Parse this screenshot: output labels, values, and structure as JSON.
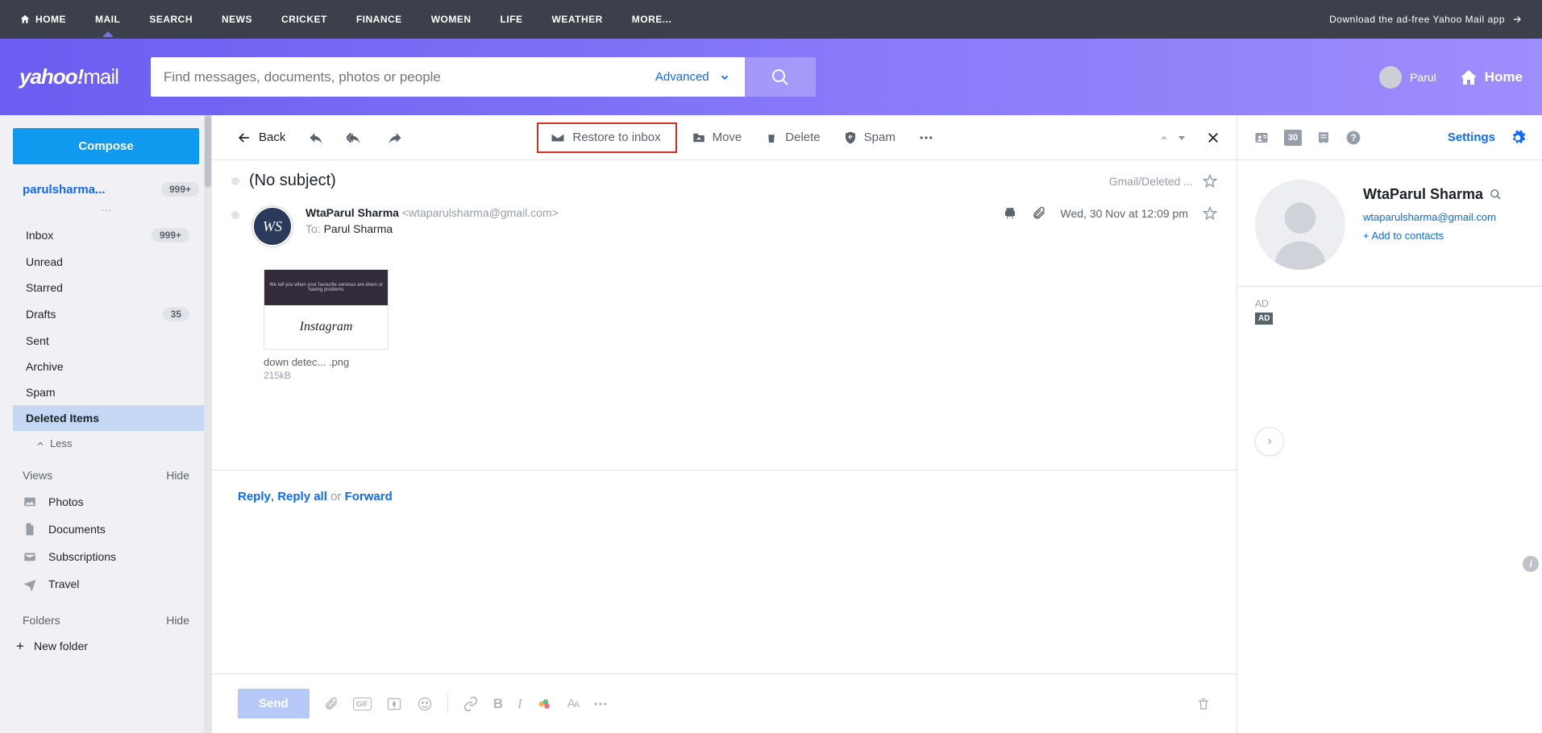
{
  "topnav": {
    "items": [
      "HOME",
      "MAIL",
      "SEARCH",
      "NEWS",
      "CRICKET",
      "FINANCE",
      "WOMEN",
      "LIFE",
      "WEATHER",
      "MORE..."
    ],
    "active_index": 1,
    "download": "Download the ad-free Yahoo Mail app"
  },
  "header": {
    "logo_a": "yahoo!",
    "logo_b": "mail",
    "search_placeholder": "Find messages, documents, photos or people",
    "advanced": "Advanced",
    "user": "Parul",
    "home": "Home"
  },
  "sidebar": {
    "compose": "Compose",
    "account": "parulsharma...",
    "account_badge": "999+",
    "folders": [
      {
        "label": "Inbox",
        "badge": "999+"
      },
      {
        "label": "Unread"
      },
      {
        "label": "Starred"
      },
      {
        "label": "Drafts",
        "badge": "35"
      },
      {
        "label": "Sent"
      },
      {
        "label": "Archive"
      },
      {
        "label": "Spam"
      },
      {
        "label": "Deleted Items",
        "active": true
      }
    ],
    "less": "Less",
    "views_head": "Views",
    "views_hide": "Hide",
    "views": [
      {
        "label": "Photos"
      },
      {
        "label": "Documents"
      },
      {
        "label": "Subscriptions"
      },
      {
        "label": "Travel"
      }
    ],
    "folders_head": "Folders",
    "folders_hide": "Hide",
    "new_folder": "New folder"
  },
  "toolbar": {
    "back": "Back",
    "restore": "Restore to inbox",
    "move": "Move",
    "delete": "Delete",
    "spam": "Spam"
  },
  "message": {
    "subject": "(No subject)",
    "location": "Gmail/Deleted ...",
    "from_name": "WtaParul Sharma",
    "from_addr": "<wtaparulsharma@gmail.com>",
    "to_label": "To:",
    "to_name": "Parul Sharma",
    "date": "Wed, 30 Nov at 12:09 pm",
    "attachment_name": "down detec... .png",
    "attachment_size": "215kB",
    "attach_logo": "Instagram",
    "reply": "Reply",
    "reply_all": "Reply all",
    "or": "or",
    "forward": "Forward",
    "send": "Send"
  },
  "rightpanel": {
    "settings": "Settings",
    "calendar_day": "30",
    "contact_name": "WtaParul Sharma",
    "contact_email": "wtaparulsharma@gmail.com",
    "add": "+ Add to contacts",
    "ad": "AD",
    "ad_badge": "AD"
  }
}
